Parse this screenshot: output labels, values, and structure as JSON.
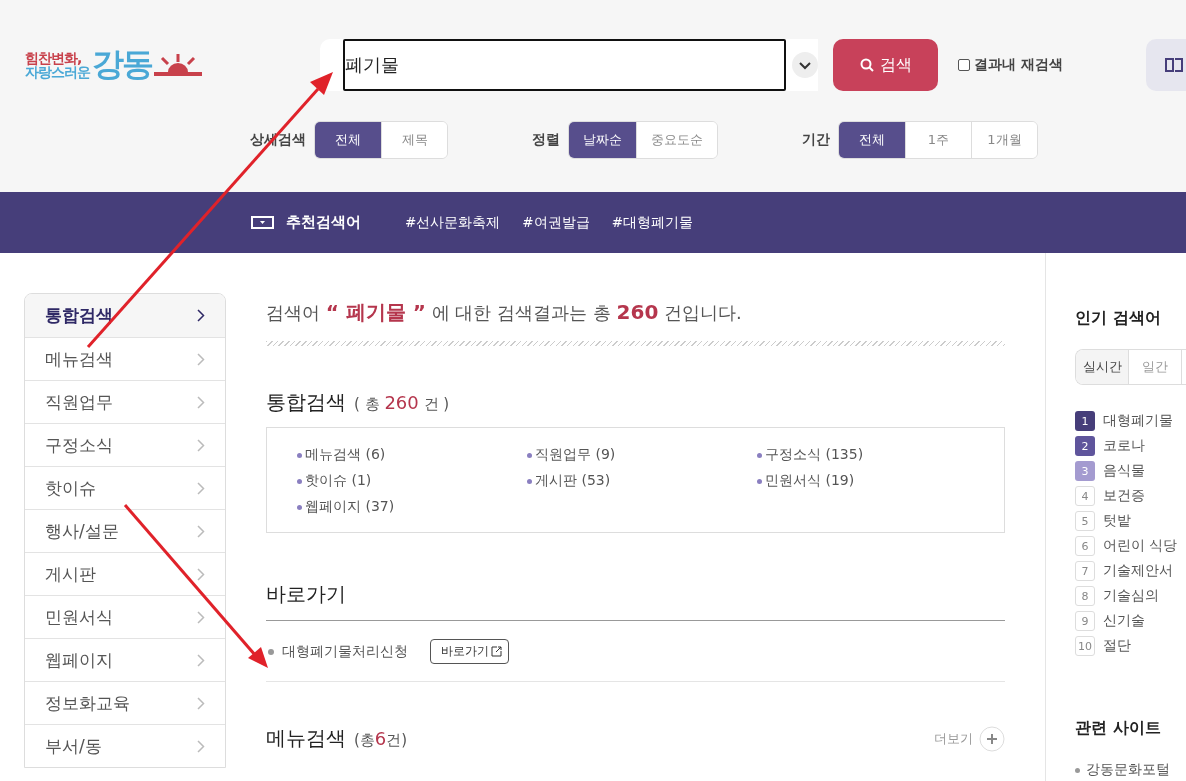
{
  "logo": {
    "line1": "힘찬변화,",
    "line2": "자랑스러운",
    "name": "강동"
  },
  "search": {
    "value": "폐기물",
    "button": "검색",
    "recheck": {
      "label": "결과내 재검색",
      "checked": false
    }
  },
  "filters": [
    {
      "label": "상세검색",
      "options": [
        {
          "label": "전체",
          "selected": true
        },
        {
          "label": "제목",
          "selected": false
        }
      ]
    },
    {
      "label": "정렬",
      "options": [
        {
          "label": "날짜순",
          "selected": true
        },
        {
          "label": "중요도순",
          "selected": false
        }
      ]
    },
    {
      "label": "기간",
      "options": [
        {
          "label": "전체",
          "selected": true
        },
        {
          "label": "1주",
          "selected": false
        },
        {
          "label": "1개월",
          "selected": false
        }
      ]
    }
  ],
  "recommend": {
    "title": "추천검색어",
    "tags": [
      "#선사문화축제",
      "#여권발급",
      "#대형폐기물"
    ]
  },
  "sidebar": {
    "items": [
      {
        "label": "통합검색",
        "selected": true
      },
      {
        "label": "메뉴검색",
        "selected": false
      },
      {
        "label": "직원업무",
        "selected": false
      },
      {
        "label": "구정소식",
        "selected": false
      },
      {
        "label": "핫이슈",
        "selected": false
      },
      {
        "label": "행사/설문",
        "selected": false
      },
      {
        "label": "게시판",
        "selected": false
      },
      {
        "label": "민원서식",
        "selected": false
      },
      {
        "label": "웹페이지",
        "selected": false
      },
      {
        "label": "정보화교육",
        "selected": false
      },
      {
        "label": "부서/동",
        "selected": false
      }
    ]
  },
  "summary": {
    "text": "검색어 **“ 폐기물 ”** 에 대한 검색결과는 총 **260** 건입니다."
  },
  "integrated": {
    "title": "통합검색",
    "count_prefix": "( 총",
    "count": "260",
    "count_suffix": "건 )",
    "items": [
      "메뉴검색 (6)",
      "직원업무 (9)",
      "구정소식 (135)",
      "핫이슈 (1)",
      "게시판 (53)",
      "민원서식 (19)",
      "웹페이지 (37)"
    ]
  },
  "shortcut": {
    "title": "바로가기",
    "items": [
      {
        "label": "대형폐기물처리신청",
        "button": "바로가기"
      }
    ]
  },
  "menu_search": {
    "title": "메뉴검색",
    "count_prefix": "(총",
    "count": "6",
    "count_suffix": "건)",
    "more": "더보기"
  },
  "popular": {
    "title": "인기 검색어",
    "tabs": [
      {
        "label": "실시간",
        "selected": true
      },
      {
        "label": "일간",
        "selected": false
      }
    ],
    "items": [
      {
        "rank": "1",
        "label": "대형폐기물",
        "color": "#463e7a"
      },
      {
        "rank": "2",
        "label": "코로나",
        "color": "#5f559c"
      },
      {
        "rank": "3",
        "label": "음식물",
        "color": "#a49bd0"
      },
      {
        "rank": "4",
        "label": "보건증"
      },
      {
        "rank": "5",
        "label": "텃밭"
      },
      {
        "rank": "6",
        "label": "어린이 식당"
      },
      {
        "rank": "7",
        "label": "기술제안서"
      },
      {
        "rank": "8",
        "label": "기술심의"
      },
      {
        "rank": "9",
        "label": "신기술"
      },
      {
        "rank": "10",
        "label": "절단"
      }
    ]
  },
  "related": {
    "title": "관련 사이트",
    "items": [
      "강동문화포털"
    ]
  }
}
